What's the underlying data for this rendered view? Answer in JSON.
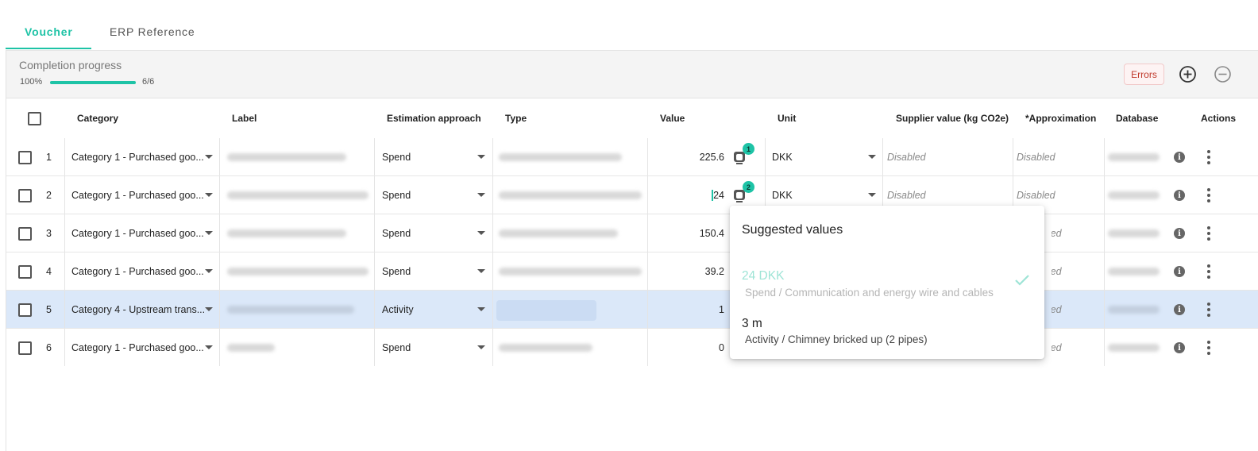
{
  "tabs": [
    {
      "label": "Voucher",
      "active": true
    },
    {
      "label": "ERP Reference",
      "active": false
    }
  ],
  "toolbar": {
    "progress_title": "Completion progress",
    "progress_percent": "100%",
    "progress_value": 1.0,
    "progress_count": "6/6",
    "errors_label": "Errors",
    "add_icon": "plus-circle-icon",
    "remove_icon": "minus-circle-icon"
  },
  "table": {
    "headers": {
      "category": "Category",
      "label": "Label",
      "estimation": "Estimation approach",
      "type": "Type",
      "value": "Value",
      "unit": "Unit",
      "supplier": "Supplier value (kg CO2e)",
      "approximation": "*Approximation",
      "database": "Database",
      "actions": "Actions"
    },
    "rows": [
      {
        "num": "1",
        "category": "Category 1 - Purchased goo...",
        "estimation": "Spend",
        "value": "225.6",
        "unit": "DKK",
        "supplier": "Disabled",
        "approximation": "Disabled",
        "suggestion_count": "1"
      },
      {
        "num": "2",
        "category": "Category 1 - Purchased goo...",
        "estimation": "Spend",
        "value": "24",
        "unit": "DKK",
        "supplier": "Disabled",
        "approximation": "Disabled",
        "suggestion_count": "2"
      },
      {
        "num": "3",
        "category": "Category 1 - Purchased goo...",
        "estimation": "Spend",
        "value": "150.4",
        "approximation": "Disabled"
      },
      {
        "num": "4",
        "category": "Category 1 - Purchased goo...",
        "estimation": "Spend",
        "value": "39.2",
        "approximation": "Disabled"
      },
      {
        "num": "5",
        "category": "Category 4 - Upstream trans...",
        "estimation": "Activity",
        "value": "1",
        "approximation": "Disabled"
      },
      {
        "num": "6",
        "category": "Category 1 - Purchased goo...",
        "estimation": "Spend",
        "value": "0",
        "approximation": "Disabled"
      }
    ]
  },
  "popup": {
    "title": "Suggested values",
    "suggestions": [
      {
        "value": "24 DKK",
        "detail": "Spend / Communication and energy wire and cables",
        "selected": true
      },
      {
        "value": "3 m",
        "detail": "Activity / Chimney bricked up (2 pipes)",
        "selected": false
      }
    ]
  },
  "colors": {
    "accent": "#1ec3a6",
    "selected_row": "#dbe8f9",
    "error": "#c0392b"
  }
}
